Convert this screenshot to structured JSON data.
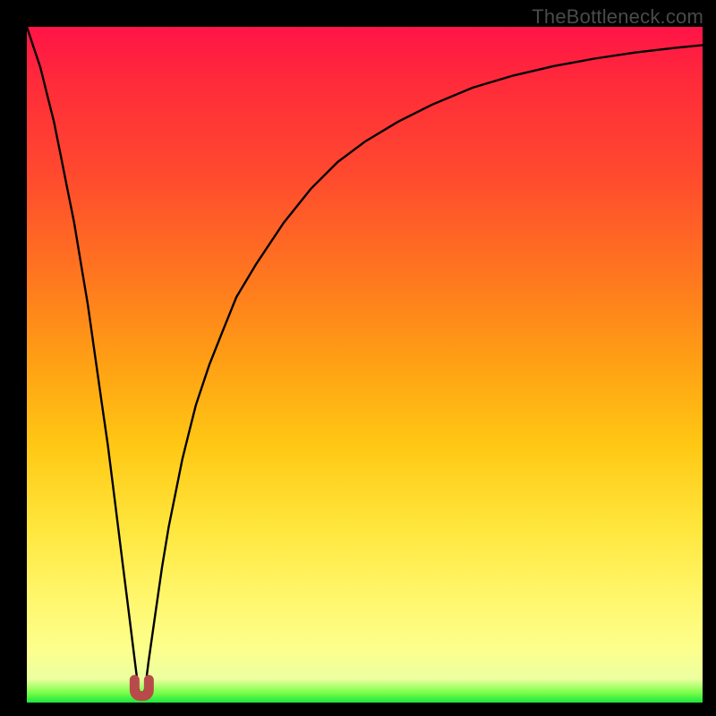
{
  "watermark": "TheBottleneck.com",
  "colors": {
    "background": "#000000",
    "curve": "#000000",
    "marker": "#b94a4a",
    "gradient_top": "#ff1448",
    "gradient_bottom": "#1ae63e"
  },
  "chart_data": {
    "type": "line",
    "title": "",
    "xlabel": "",
    "ylabel": "",
    "xlim": [
      0,
      100
    ],
    "ylim": [
      0,
      100
    ],
    "grid": false,
    "legend": false,
    "axes_visible": false,
    "note": "Axes, ticks, and units are not shown in the image. y-values are read as percent of plot height from bottom (0) to top (100); x-values as percent from left (0) to right (100). The curve has a sharp cusp/minimum near x≈17 (y≈0) and rises asymptotically toward y≈100 on both sides.",
    "series": [
      {
        "name": "curve",
        "x": [
          0,
          1,
          2,
          3,
          4,
          5,
          6,
          7,
          8,
          9,
          10,
          11,
          12,
          13,
          14,
          15,
          16,
          16.5,
          17,
          17.5,
          18,
          19,
          20,
          21,
          22,
          23,
          24,
          25,
          27,
          29,
          31,
          34,
          38,
          42,
          46,
          50,
          55,
          60,
          66,
          72,
          78,
          84,
          90,
          96,
          100
        ],
        "y": [
          100,
          97,
          94,
          90,
          86,
          81,
          76,
          71,
          65,
          59,
          52,
          45,
          38,
          30,
          22,
          14,
          6,
          2,
          0.5,
          2,
          6,
          13,
          20,
          26,
          31,
          36,
          40,
          44,
          50,
          55,
          60,
          65,
          71,
          76,
          80,
          83,
          86,
          88.5,
          91,
          92.8,
          94.2,
          95.3,
          96.2,
          96.9,
          97.3
        ]
      }
    ],
    "marker": {
      "shape": "u",
      "x": 17,
      "y": 1.5,
      "color": "#b94a4a"
    }
  }
}
